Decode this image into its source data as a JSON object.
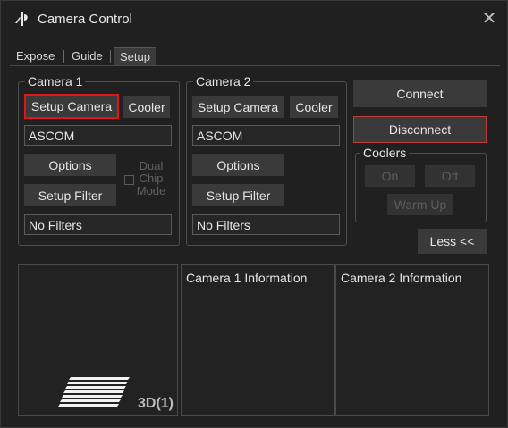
{
  "window": {
    "title": "Camera Control",
    "close_glyph": "✕",
    "icon": "app-logo-icon"
  },
  "tabs": [
    {
      "label": "Expose",
      "active": false
    },
    {
      "label": "Guide",
      "active": false
    },
    {
      "label": "Setup",
      "active": true
    }
  ],
  "camera1": {
    "legend": "Camera 1",
    "setup_camera": "Setup Camera",
    "cooler": "Cooler",
    "driver": "ASCOM",
    "options": "Options",
    "setup_filter": "Setup Filter",
    "filters": "No Filters"
  },
  "camera2": {
    "legend": "Camera 2",
    "setup_camera": "Setup Camera",
    "cooler": "Cooler",
    "driver": "ASCOM",
    "options": "Options",
    "setup_filter": "Setup Filter",
    "filters": "No Filters"
  },
  "dual_chip": {
    "line1": "Dual",
    "line2": "Chip",
    "line3": "Mode"
  },
  "actions": {
    "connect": "Connect",
    "disconnect": "Disconnect",
    "less": "Less <<"
  },
  "coolers": {
    "legend": "Coolers",
    "on": "On",
    "off": "Off",
    "warm_up": "Warm Up"
  },
  "info": {
    "badge": "3D(1)",
    "camera1_title": "Camera 1 Information",
    "camera2_title": "Camera 2 Information"
  },
  "colors": {
    "accent_red": "#e01616",
    "disconnect_border": "#c03a3a",
    "button": "#3a3a3a",
    "background": "#202020"
  }
}
